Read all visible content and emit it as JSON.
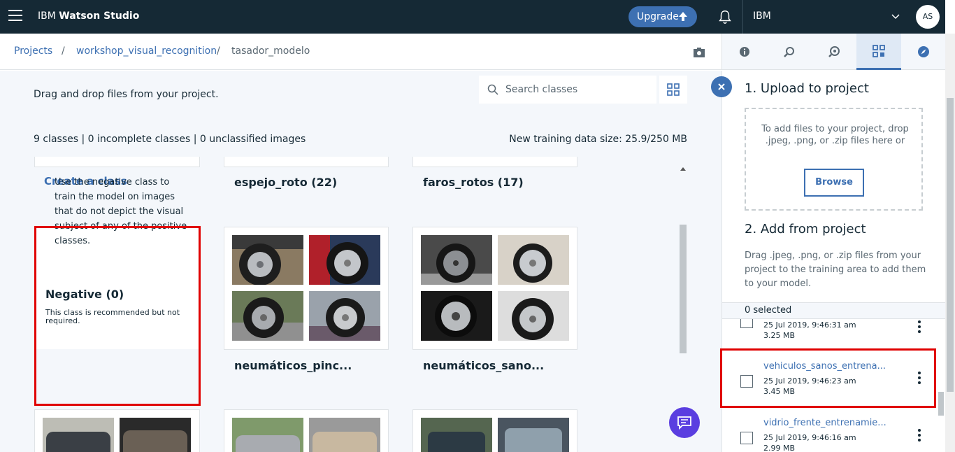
{
  "topbar": {
    "brand_prefix": "IBM",
    "brand_name": "Watson Studio",
    "upgrade_label": "Upgrade",
    "account_name": "IBM",
    "avatar_initials": "AS"
  },
  "breadcrumb": {
    "items": [
      "Projects",
      "workshop_visual_recognition",
      "tasador_modelo"
    ],
    "separator": "/"
  },
  "main": {
    "hint": "Drag and drop files from your project.",
    "search_placeholder": "Search classes",
    "stats": "9 classes | 0 incomplete classes | 0 unclassified images",
    "data_size": "New training data size: 25.9/250 MB",
    "create_class": "Create a class",
    "classes": [
      {
        "title": "espejo_roto (22)"
      },
      {
        "title": "faros_rotos (17)"
      },
      {
        "title": "neumáticos_pinc..."
      },
      {
        "title": "neumáticos_sano..."
      }
    ],
    "negative": {
      "description": "Use the negative class to train the model on images that do not depict the visual subject of any of the positive classes.",
      "title": "Negative (0)",
      "subtitle": "This class is recommended but not required."
    }
  },
  "panel": {
    "upload_heading": "1. Upload to project",
    "drop_text": "To add files to your project, drop .jpeg, .png, or .zip files here or",
    "browse_label": "Browse",
    "add_heading": "2. Add from project",
    "add_desc": "Drag .jpeg, .png, or .zip files from your project to the training area to add them to your model.",
    "selected": "0 selected",
    "files": [
      {
        "name": "",
        "date": "25 Jul 2019, 9:46:31 am",
        "size": "3.25 MB"
      },
      {
        "name": "vehiculos_sanos_entrena...",
        "date": "25 Jul 2019, 9:46:23 am",
        "size": "3.45 MB"
      },
      {
        "name": "vidrio_frente_entrenamie...",
        "date": "25 Jul 2019, 9:46:16 am",
        "size": "2.99 MB"
      }
    ]
  },
  "colors": {
    "topbar": "#152935",
    "accent": "#3d70b2",
    "highlight": "#e00000",
    "chat": "#5a3ee0"
  }
}
